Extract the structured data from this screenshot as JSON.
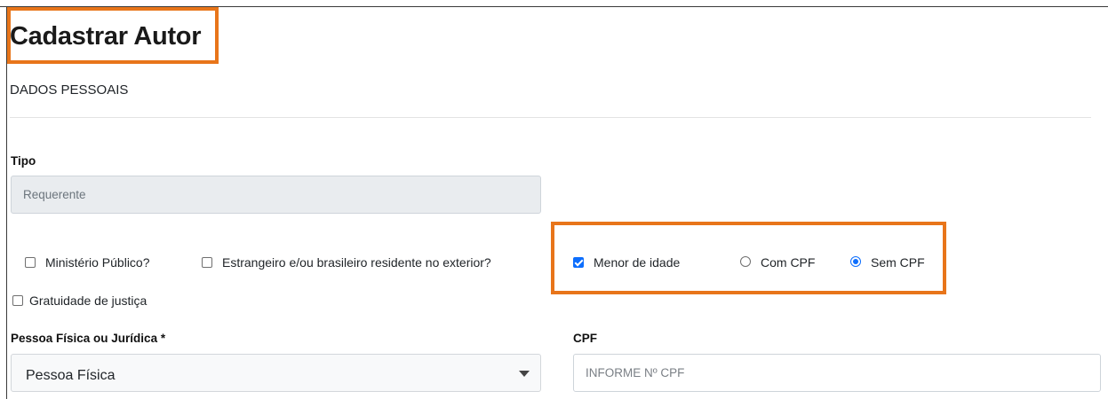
{
  "page": {
    "title": "Cadastrar Autor",
    "section": "DADOS PESSOAIS"
  },
  "tipo": {
    "label": "Tipo",
    "value": "Requerente"
  },
  "options": {
    "ministerio_publico": {
      "label": "Ministério Público?",
      "checked": false
    },
    "estrangeiro": {
      "label": "Estrangeiro e/ou brasileiro residente no exterior?",
      "checked": false
    },
    "menor_idade": {
      "label": "Menor de idade",
      "checked": true
    },
    "com_cpf": {
      "label": "Com CPF",
      "selected": false
    },
    "sem_cpf": {
      "label": "Sem CPF",
      "selected": true
    },
    "gratuidade": {
      "label": "Gratuidade de justiça",
      "checked": false
    }
  },
  "pessoa": {
    "label": "Pessoa Física ou Jurídica *",
    "value": "Pessoa Física"
  },
  "cpf": {
    "label": "CPF",
    "placeholder": "INFORME Nº CPF",
    "value": ""
  },
  "colors": {
    "highlight": "#e8751a",
    "accent": "#0d6efd",
    "disabled_bg": "#e9ecef"
  }
}
